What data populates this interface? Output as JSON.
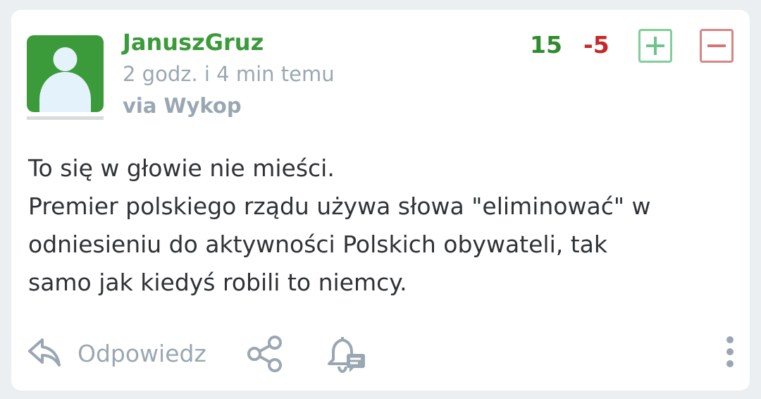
{
  "entry": {
    "author": "JanuszGruz",
    "time_ago": "2 godz. i 4 min temu",
    "source": "via Wykop",
    "votes": {
      "plus": "15",
      "minus": "-5"
    },
    "body_lines": [
      "To się w głowie nie mieści.",
      "Premier polskiego rządu używa słowa \"eliminować\" w",
      "odniesieniu do aktywności Polskich obywateli, tak",
      "samo jak kiedyś robili to niemcy."
    ]
  },
  "actions": {
    "reply_label": "Odpowiedz",
    "icons": [
      "reply-icon",
      "share-icon",
      "notification-bell-icon",
      "more-options-icon"
    ]
  },
  "colors": {
    "author": "#3b9b3b",
    "plus": "#2e8b2e",
    "minus": "#c62828",
    "muted": "#9aa7b2"
  }
}
